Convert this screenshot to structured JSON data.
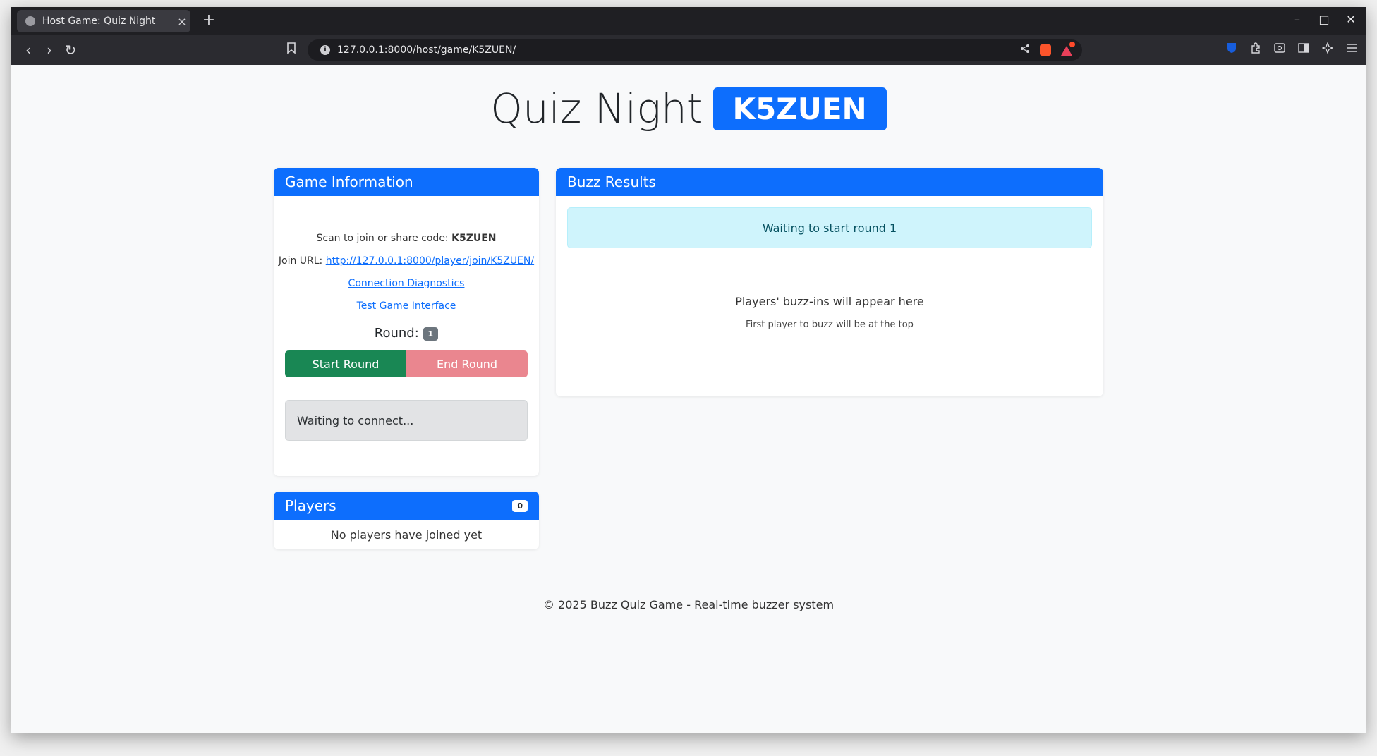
{
  "browser": {
    "tab_title": "Host Game: Quiz Night",
    "tab_close": "×",
    "new_tab": "+",
    "url": "127.0.0.1:8000/host/game/K5ZUEN/",
    "icons": [
      "globe-icon",
      "close-icon",
      "plus-icon",
      "back-icon",
      "forward-icon",
      "reload-icon",
      "bookmark-icon",
      "site-info-icon",
      "share-icon",
      "brave-shields-icon",
      "brave-rewards-icon",
      "bitwarden-icon",
      "extensions-icon",
      "screenshot-icon",
      "sidebar-icon",
      "leo-icon",
      "menu-icon"
    ],
    "window_controls": {
      "minimize": "–",
      "maximize": "□",
      "close": "✕"
    },
    "nav": {
      "back": "‹",
      "forward": "›",
      "reload": "↻"
    }
  },
  "header": {
    "title": "Quiz Night",
    "code": "K5ZUEN"
  },
  "game_info": {
    "heading": "Game Information",
    "scan_text": "Scan to join or share code: ",
    "code": "K5ZUEN",
    "join_label": "Join URL: ",
    "join_url": "http://127.0.0.1:8000/player/join/K5ZUEN/",
    "diagnostics_link": "Connection Diagnostics",
    "test_link": "Test Game Interface",
    "round_label": "Round:",
    "round_value": "1",
    "start_button": "Start Round",
    "end_button": "End Round",
    "status": "Waiting to connect..."
  },
  "players": {
    "heading": "Players",
    "count": "0",
    "empty_text": "No players have joined yet"
  },
  "buzz": {
    "heading": "Buzz Results",
    "alert": "Waiting to start round 1",
    "main_text": "Players' buzz-ins will appear here",
    "sub_text": "First player to buzz will be at the top"
  },
  "footer": {
    "text": "© 2025 Buzz Quiz Game - Real-time buzzer system"
  },
  "colors": {
    "primary": "#0d6efd",
    "success": "#198754",
    "danger_light": "#ea868f",
    "info_bg": "#cff4fc"
  }
}
